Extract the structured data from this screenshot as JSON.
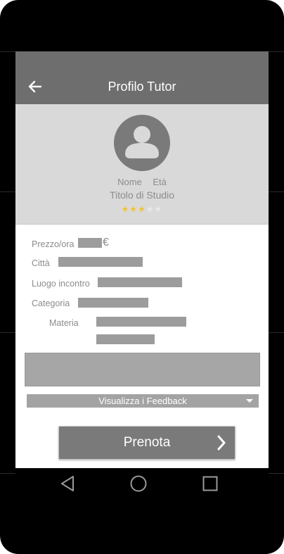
{
  "header": {
    "title": "Profilo Tutor",
    "back_icon": "arrow-left-icon"
  },
  "profile": {
    "avatar_icon": "user-avatar-icon",
    "name_label": "Nome",
    "age_label": "Età",
    "degree_label": "Titolo di Studio",
    "rating": {
      "value": 3,
      "max": 5
    }
  },
  "details": {
    "price_label": "Prezzo/ora",
    "currency": "€",
    "city_label": "Città",
    "meeting_place_label": "Luogo incontro",
    "category_label": "Categoria",
    "subject_label": "Materia"
  },
  "feedback_dropdown": {
    "selected": "Visualizza i Feedback"
  },
  "book_button": {
    "label": "Prenota",
    "icon": "chevron-right-icon"
  },
  "nav": {
    "back_icon": "nav-back-triangle-icon",
    "home_icon": "nav-home-circle-icon",
    "recents_icon": "nav-recents-square-icon"
  },
  "colors": {
    "appbar": "#6e6e6e",
    "profile_bg": "#d9d9d9",
    "star_on": "#f2c230",
    "placeholder": "#9c9c9c"
  }
}
